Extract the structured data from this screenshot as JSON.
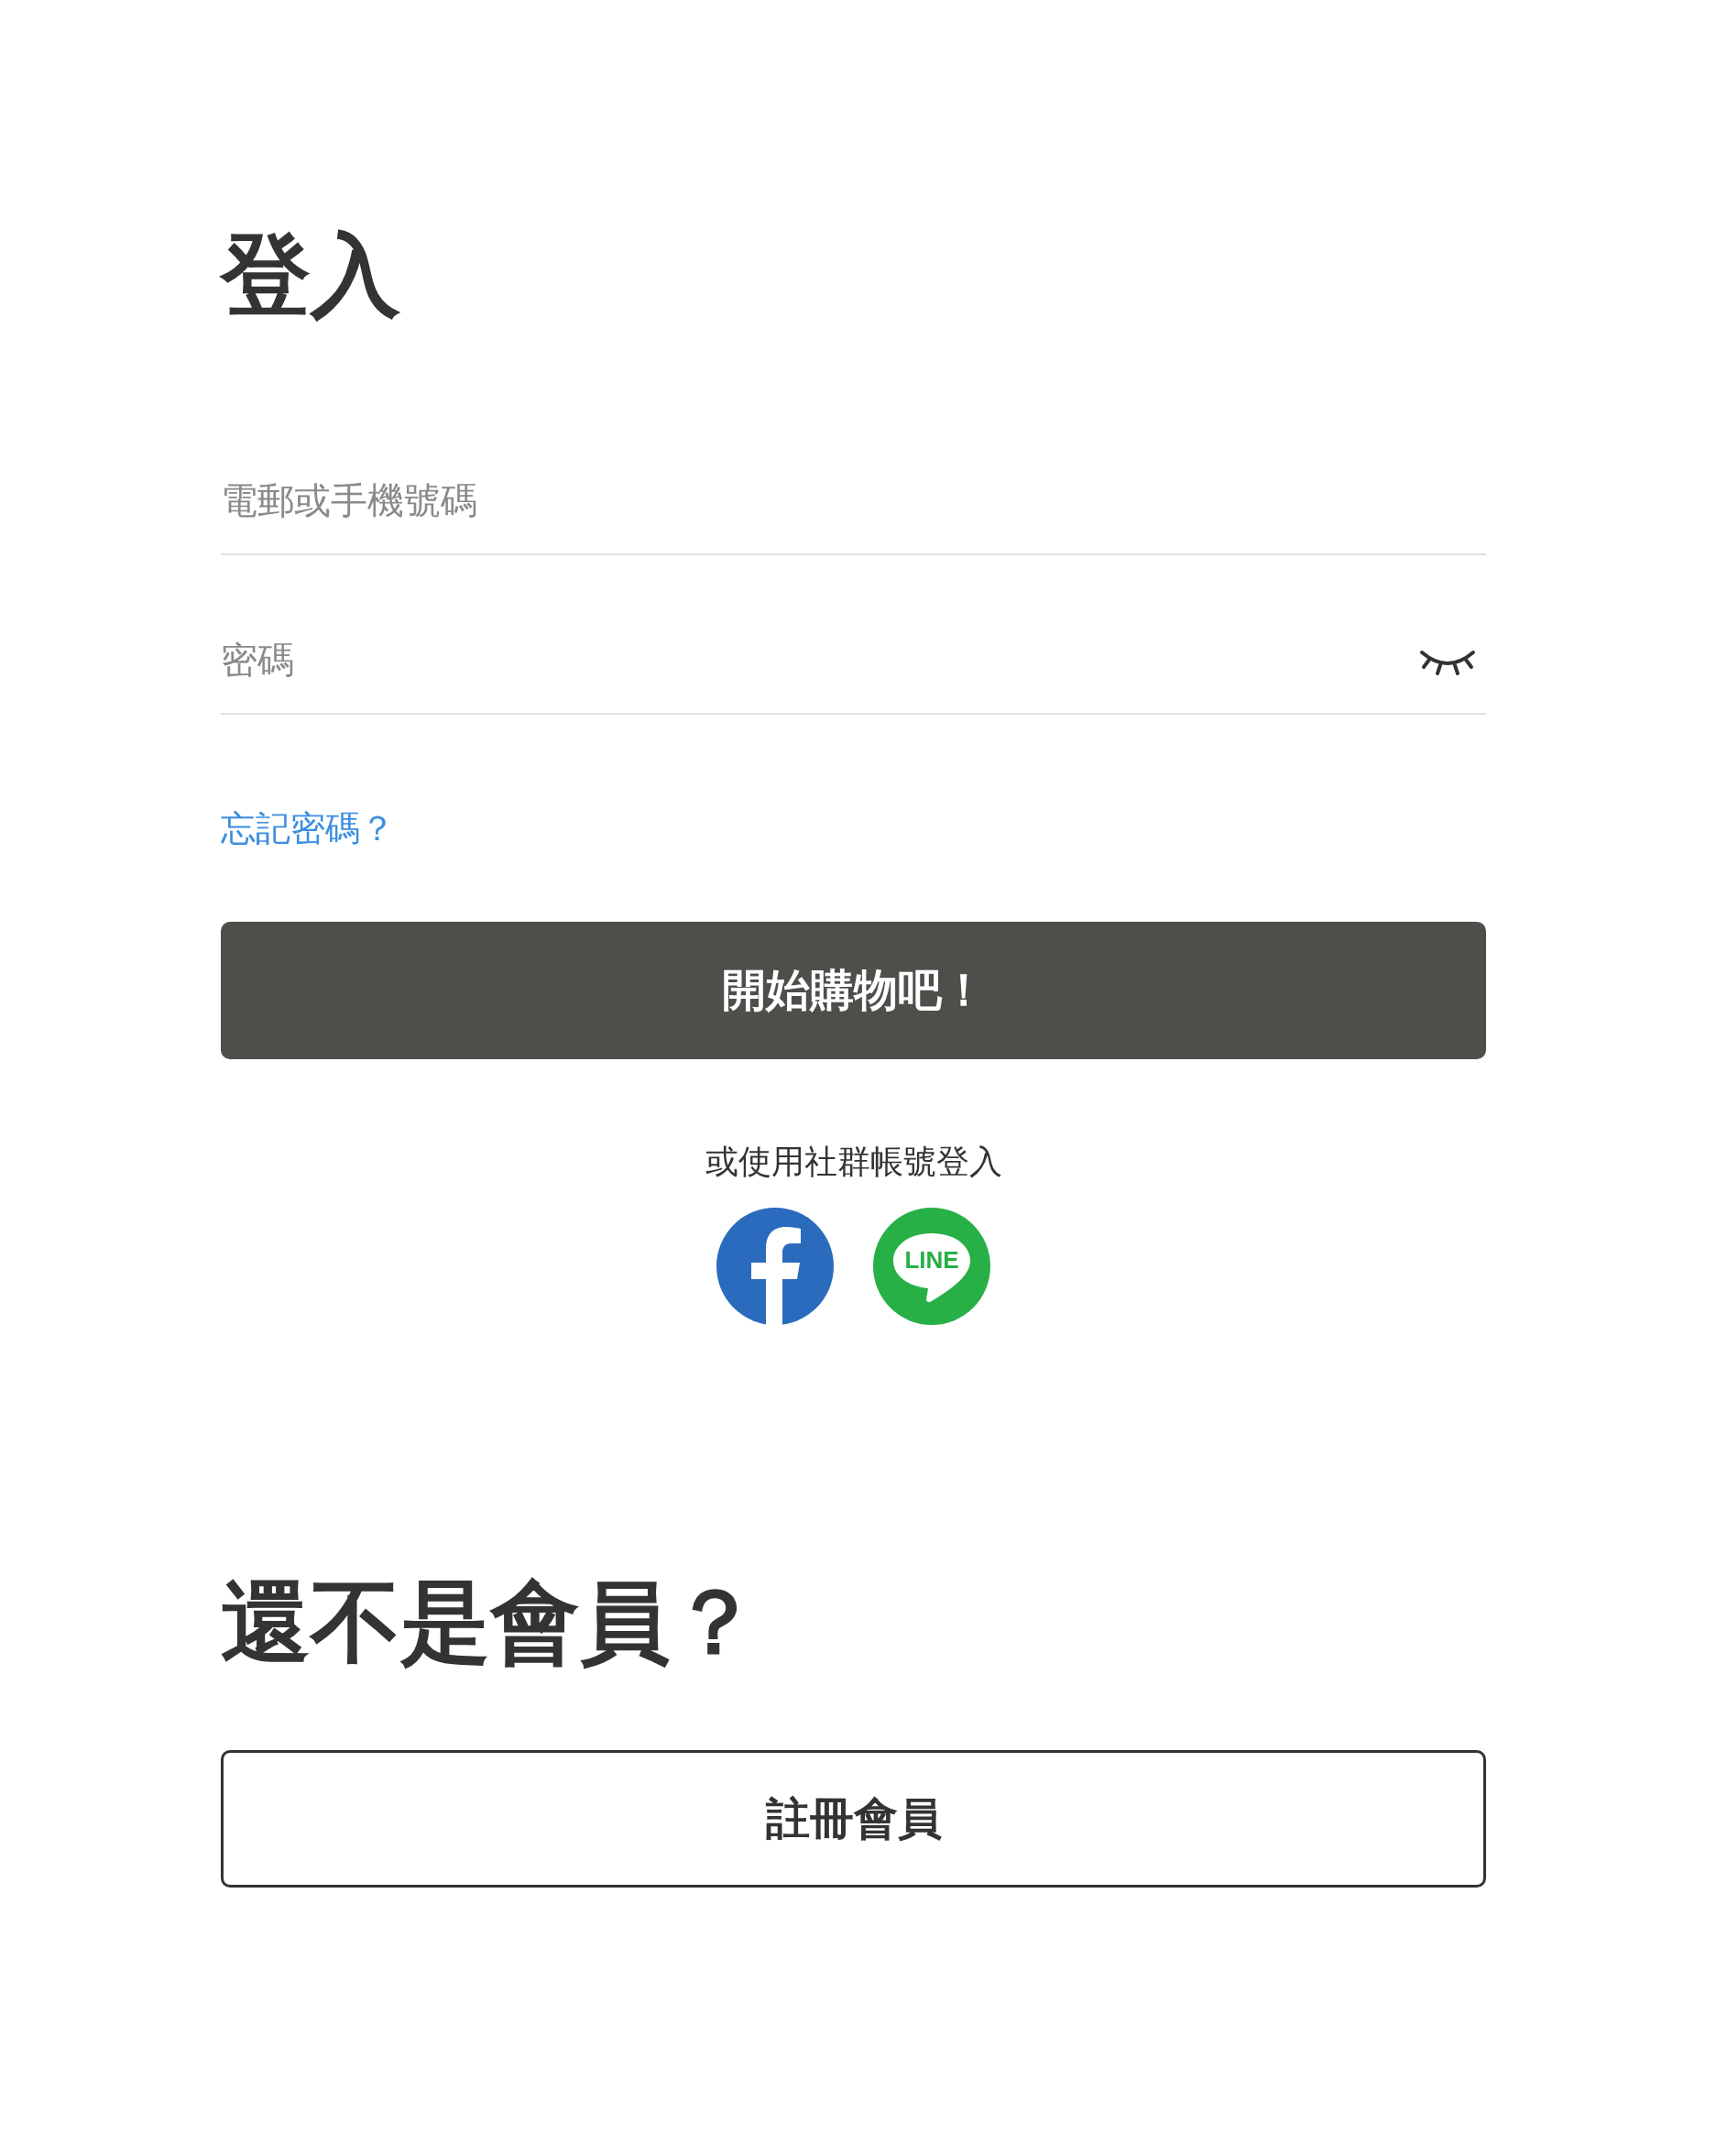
{
  "login": {
    "title": "登入",
    "fields": [
      {
        "kind": "text",
        "placeholder": "電郵或手機號碼"
      },
      {
        "kind": "password",
        "placeholder": "密碼",
        "password_visible": false
      }
    ],
    "forgot_link": "忘記密碼？",
    "submit_button": "開始購物吧！",
    "social_label": "或使用社群帳號登入",
    "social": [
      {
        "kind": "facebook"
      },
      {
        "kind": "line",
        "text": "LINE"
      }
    ]
  },
  "signup": {
    "title": "還不是會員？",
    "button": "註冊會員"
  }
}
